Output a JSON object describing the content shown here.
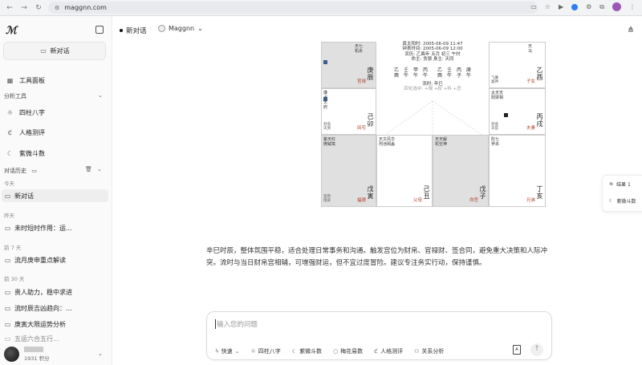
{
  "browser": {
    "url": "maggnn.com"
  },
  "sidebar": {
    "new_chat_label": "新对话",
    "tools_panel_label": "工具面板",
    "analysis_section": "分析工具",
    "tools": [
      "四柱八字",
      "人格测评",
      "紫微斗数"
    ],
    "history_section": "对话历史",
    "groups": [
      {
        "label": "今天",
        "items": [
          "新对话"
        ]
      },
      {
        "label": "昨天",
        "items": [
          "未时短时作用：运..."
        ]
      },
      {
        "label": "前 7 天",
        "items": [
          "流月庚申重点解读"
        ]
      },
      {
        "label": "前 30 天",
        "items": [
          "贵人助力，稳中求进",
          "流时辰吉凶趋向：...",
          "庚寅大限运势分析",
          "五运六合五行..."
        ]
      }
    ],
    "user_points": "1931 积分"
  },
  "header": {
    "title": "新对话",
    "model": "Maggnn"
  },
  "chart": {
    "center_lines": [
      "真太阳时: 2005-06-09 11:47",
      "钟表时间: 2005-06-09 12:00",
      "农历: 乙酉年 五月 初三 午时",
      "命主: 贪狼 身主: 天同"
    ],
    "pillars_top": [
      "乙",
      "壬",
      "甲",
      "丙",
      "乙",
      "壬",
      "丙",
      "庚"
    ],
    "pillars_bottom": [
      "酉",
      "午",
      "午",
      "午",
      "酉",
      "午",
      "子",
      "午"
    ],
    "flow_label": "流时: 辛巳",
    "sihua_label": "四化选中: +禄 +权 +科 +忌",
    "cells": [
      {
        "gz": "庚辰",
        "palace": "官禄",
        "shade": true
      },
      {
        "gz": "乙酉",
        "palace": "子女",
        "shade": false
      },
      {
        "gz": "己卯",
        "palace": "田宅",
        "shade": false
      },
      {
        "gz": "丙戌",
        "palace": "夫妻",
        "shade": false
      },
      {
        "gz": "戊寅",
        "palace": "福德",
        "shade": true
      },
      {
        "gz": "己丑",
        "palace": "父母",
        "shade": false
      },
      {
        "gz": "戊子",
        "palace": "命宫",
        "shade": true
      },
      {
        "gz": "丁亥",
        "palace": "兄弟",
        "shade": false
      }
    ]
  },
  "answer": "辛巳时辰，整体氛围平稳，适合处理日常事务和沟通。触发宫位为财帛、官禄财、签合同，避免重大决策和人际冲突。流时与当日财帛宫相辅，可增强财运，但不宜过度冒险。建议专注务实行动，保持谨慎。",
  "input": {
    "placeholder": "输入您的问题",
    "tools": [
      "快速",
      "四柱八字",
      "紫微斗数",
      "梅花易数",
      "人格测评",
      "关系分析"
    ]
  },
  "float_panel": {
    "results_label": "结果 1",
    "item_label": "紫微斗数"
  }
}
